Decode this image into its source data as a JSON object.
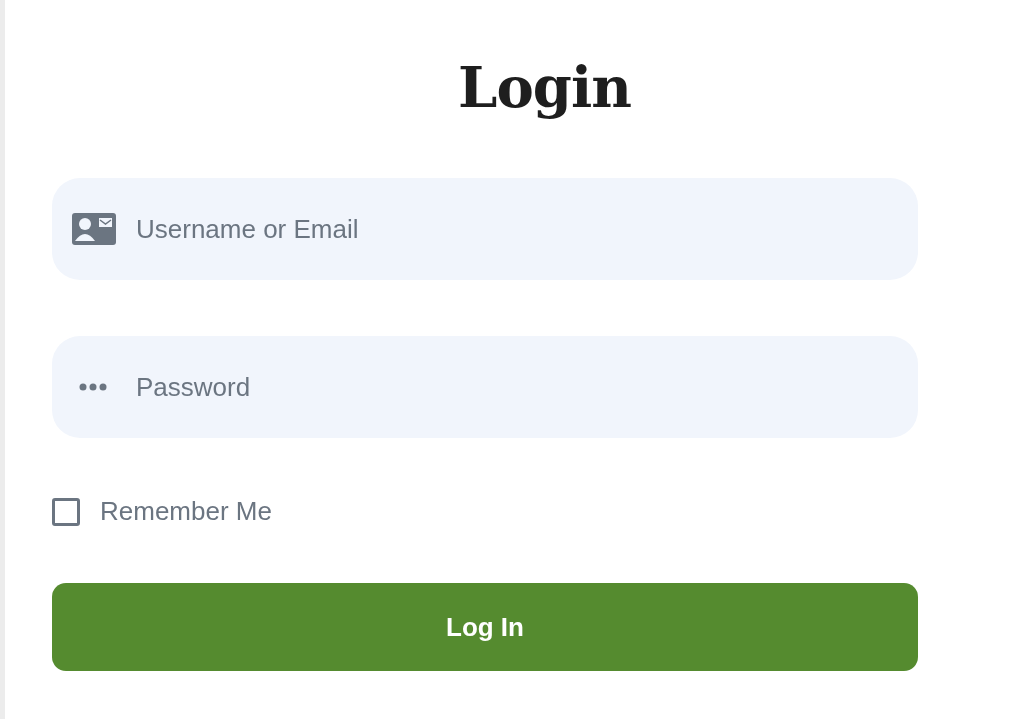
{
  "title": "Login",
  "fields": [
    {
      "kind": "username",
      "placeholder": "Username or Email"
    },
    {
      "kind": "password",
      "placeholder": "Password"
    }
  ],
  "remember": {
    "label": "Remember Me",
    "checked": false
  },
  "submit": {
    "label": "Log In"
  }
}
